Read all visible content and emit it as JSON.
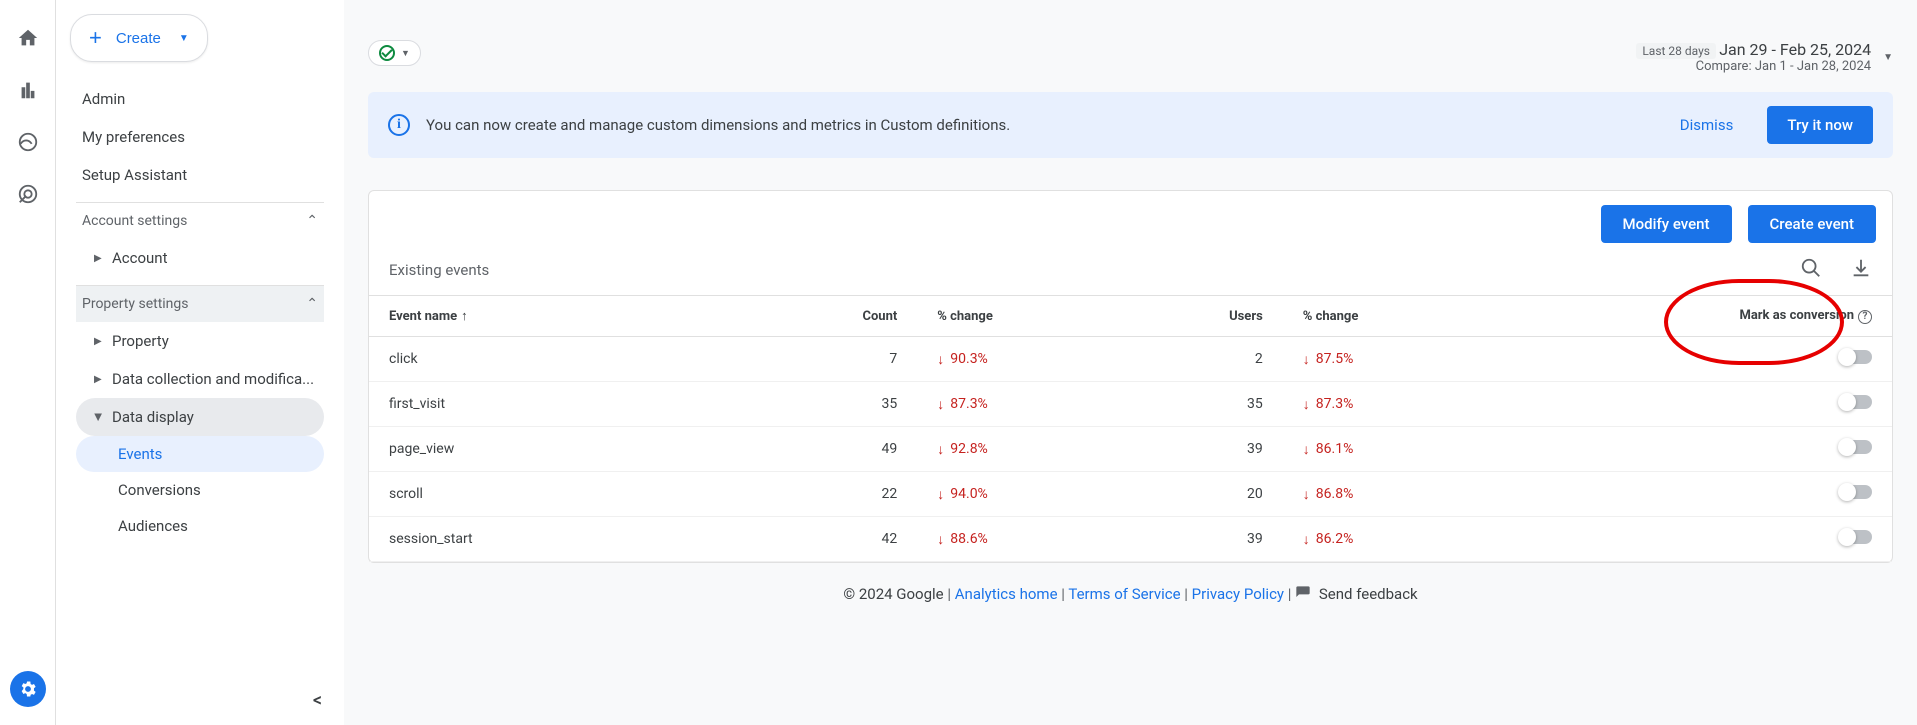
{
  "create_label": "Create",
  "sidebar": {
    "admin": "Admin",
    "prefs": "My preferences",
    "setup": "Setup Assistant",
    "account_settings": "Account settings",
    "account": "Account",
    "property_settings": "Property settings",
    "property": "Property",
    "data_collection": "Data collection and modifica...",
    "data_display": "Data display",
    "events": "Events",
    "conversions": "Conversions",
    "audiences": "Audiences"
  },
  "date": {
    "label": "Last 28 days",
    "range": "Jan 29 - Feb 25, 2024",
    "compare": "Compare: Jan 1 - Jan 28, 2024"
  },
  "banner": {
    "msg": "You can now create and manage custom dimensions and metrics in Custom definitions.",
    "dismiss": "Dismiss",
    "try": "Try it now"
  },
  "buttons": {
    "modify": "Modify event",
    "create": "Create event"
  },
  "table": {
    "title": "Existing events",
    "headers": {
      "event": "Event name",
      "count": "Count",
      "change1": "% change",
      "users": "Users",
      "change2": "% change",
      "mark": "Mark as conversion"
    },
    "rows": [
      {
        "name": "click",
        "count": "7",
        "c1": "90.3%",
        "users": "2",
        "c2": "87.5%"
      },
      {
        "name": "first_visit",
        "count": "35",
        "c1": "87.3%",
        "users": "35",
        "c2": "87.3%"
      },
      {
        "name": "page_view",
        "count": "49",
        "c1": "92.8%",
        "users": "39",
        "c2": "86.1%"
      },
      {
        "name": "scroll",
        "count": "22",
        "c1": "94.0%",
        "users": "20",
        "c2": "86.8%"
      },
      {
        "name": "session_start",
        "count": "42",
        "c1": "88.6%",
        "users": "39",
        "c2": "86.2%"
      }
    ]
  },
  "footer": {
    "copyright": "© 2024 Google",
    "home": "Analytics home",
    "tos": "Terms of Service",
    "privacy": "Privacy Policy",
    "feedback": "Send feedback"
  }
}
